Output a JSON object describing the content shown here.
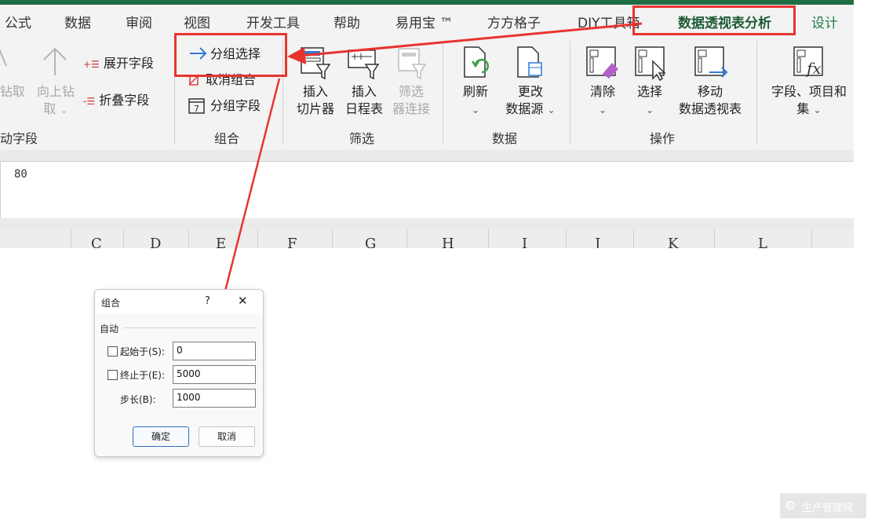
{
  "tabs": [
    "公式",
    "数据",
    "审阅",
    "视图",
    "开发工具",
    "帮助",
    "易用宝 ™",
    "方方格子",
    "DIY工具箱",
    "数据透视表分析",
    "设计"
  ],
  "ribbon": {
    "active_field": {
      "drill_down": "钻取",
      "drill_up_l1": "向上钻",
      "drill_up_l2": "取",
      "expand_field": "展开字段",
      "collapse_field": "折叠字段",
      "group_label": "动字段"
    },
    "group": {
      "group_selection": "分组选择",
      "ungroup": "取消组合",
      "group_field": "分组字段",
      "group_label": "组合"
    },
    "filter": {
      "insert_slicer_l1": "插入",
      "insert_slicer_l2": "切片器",
      "insert_timeline_l1": "插入",
      "insert_timeline_l2": "日程表",
      "filter_conn_l1": "筛选",
      "filter_conn_l2": "器连接",
      "group_label": "筛选"
    },
    "data": {
      "refresh": "刷新",
      "change_source_l1": "更改",
      "change_source_l2": "数据源",
      "group_label": "数据"
    },
    "actions": {
      "clear": "清除",
      "select": "选择",
      "move_l1": "移动",
      "move_l2": "数据透视表",
      "group_label": "操作"
    },
    "calc": {
      "fields_items_l1": "字段、项目和",
      "fields_items_l2": "集"
    }
  },
  "formula_bar": {
    "value": "80"
  },
  "columns": [
    "C",
    "D",
    "E",
    "F",
    "G",
    "H",
    "I",
    "J",
    "K",
    "L"
  ],
  "dialog": {
    "title": "组合",
    "help": "?",
    "close": "✕",
    "section": "自动",
    "start_label": "起始于(S):",
    "start_value": "0",
    "end_label": "终止于(E):",
    "end_value": "5000",
    "step_label": "步长(B):",
    "step_value": "1000",
    "ok": "确定",
    "cancel": "取消"
  },
  "watermark": "生产管理网",
  "colors": {
    "accent_green": "#1f6e43",
    "highlight_red": "#e8342f",
    "icon_blue": "#2f7ad8",
    "icon_green": "#3aa04a",
    "icon_purple": "#b060c8"
  }
}
